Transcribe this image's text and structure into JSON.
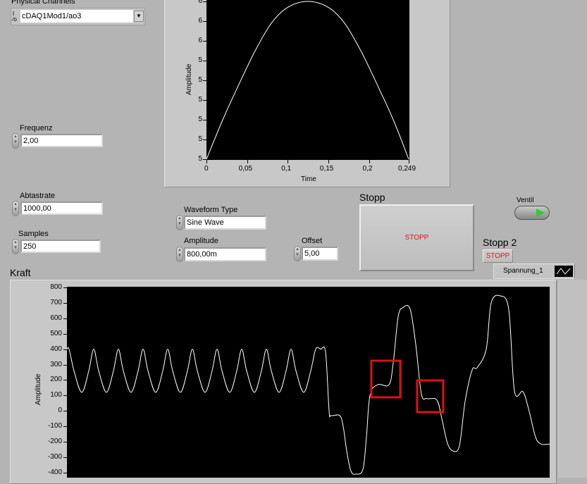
{
  "controls": {
    "physical_channels": {
      "label": "Physical Channels",
      "value": "cDAQ1Mod1/ao3",
      "io_icon": "I/O"
    },
    "frequenz": {
      "label": "Frequenz",
      "value": "2,00"
    },
    "abtastrate": {
      "label": "Abtastrate",
      "value": "1000,00"
    },
    "samples": {
      "label": "Samples",
      "value": "250"
    },
    "waveform_type": {
      "label": "Waveform Type",
      "value": "Sine Wave"
    },
    "amplitude": {
      "label": "Amplitude",
      "value": "800,00m"
    },
    "offset": {
      "label": "Offset",
      "value": "5,00"
    },
    "stopp": {
      "label": "Stopp",
      "button": "STOPP"
    },
    "stopp2": {
      "label": "Stopp 2",
      "button": "STOPP"
    },
    "ventil": {
      "label": "Ventil",
      "state": true
    }
  },
  "colors": {
    "plot_bg": "#000000",
    "trace": "#ffffff",
    "stop_text": "#e0141e",
    "led_on": "#2ecc2e",
    "highlight": "#e01010"
  },
  "chart_data": [
    {
      "type": "line",
      "title": "",
      "xlabel": "Time",
      "ylabel": "Amplitude",
      "xlim": [
        0,
        0.249
      ],
      "ylim": [
        5.0,
        5.8
      ],
      "x_ticks": [
        "0",
        "0,05",
        "0,1",
        "0,15",
        "0,2",
        "0,249"
      ],
      "x_tick_values": [
        0,
        0.05,
        0.1,
        0.15,
        0.2,
        0.249
      ],
      "y_ticks": [
        "5",
        "5",
        "5",
        "5",
        "5",
        "5",
        "6",
        "6",
        "6"
      ],
      "y_tick_values": [
        5.0,
        5.1,
        5.2,
        5.3,
        5.4,
        5.5,
        5.6,
        5.7,
        5.8
      ],
      "x": [
        0,
        0.02,
        0.04,
        0.06,
        0.08,
        0.1,
        0.125,
        0.15,
        0.17,
        0.19,
        0.21,
        0.23,
        0.249
      ],
      "y": [
        5.0,
        5.2,
        5.38,
        5.55,
        5.69,
        5.77,
        5.8,
        5.77,
        5.69,
        5.55,
        5.38,
        5.2,
        5.0
      ]
    },
    {
      "type": "line",
      "title": "Kraft",
      "xlabel": "",
      "ylabel": "Amplitude",
      "legend": [
        "Spannung_1"
      ],
      "legend_placement": "top-right",
      "xlim": [
        0,
        685
      ],
      "ylim": [
        -420,
        810
      ],
      "y_ticks": [
        "800",
        "700",
        "600",
        "500",
        "400",
        "300",
        "200",
        "100",
        "0",
        "-100",
        "-200",
        "-300",
        "-400"
      ],
      "y_tick_values": [
        800,
        700,
        600,
        500,
        400,
        300,
        200,
        100,
        0,
        -100,
        -200,
        -300,
        -400
      ],
      "series": [
        {
          "name": "Spannung_1",
          "x": [
            0,
            3,
            10,
            21,
            31,
            38,
            45,
            56,
            66,
            73,
            80,
            91,
            101,
            108,
            115,
            126,
            136,
            143,
            150,
            161,
            171,
            178,
            185,
            196,
            206,
            213,
            220,
            231,
            241,
            248,
            255,
            266,
            276,
            283,
            290,
            301,
            311,
            318,
            325,
            336,
            346,
            353,
            360,
            367,
            372,
            375,
            387,
            392,
            397,
            403,
            410,
            420,
            425,
            430,
            441,
            457,
            463,
            470,
            477,
            487,
            495,
            503,
            511,
            525,
            532,
            540,
            548,
            557,
            565,
            575,
            582,
            595,
            602,
            615,
            627,
            635,
            647,
            655,
            665,
            673,
            685
          ],
          "y": [
            400,
            400,
            260,
            120,
            260,
            400,
            260,
            120,
            260,
            400,
            260,
            120,
            260,
            400,
            260,
            120,
            260,
            400,
            260,
            120,
            260,
            400,
            260,
            120,
            260,
            400,
            260,
            120,
            260,
            400,
            260,
            120,
            260,
            400,
            260,
            120,
            260,
            400,
            260,
            120,
            260,
            400,
            400,
            380,
            0,
            -30,
            -30,
            -100,
            -260,
            -390,
            -410,
            -380,
            -170,
            100,
            170,
            170,
            310,
            610,
            670,
            660,
            430,
            110,
            80,
            70,
            -50,
            -210,
            -260,
            -225,
            60,
            265,
            280,
            400,
            700,
            745,
            655,
            130,
            125,
            15,
            -170,
            -215,
            -215
          ]
        }
      ],
      "annotations": [
        "highlight-box-1",
        "highlight-box-2"
      ]
    }
  ]
}
